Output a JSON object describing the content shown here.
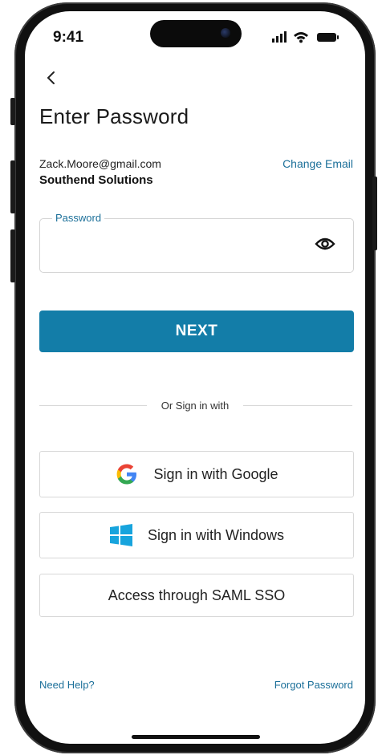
{
  "status_bar": {
    "time": "9:41"
  },
  "nav": {
    "back_glyph": "‹"
  },
  "page": {
    "title": "Enter Password",
    "email": "Zack.Moore@gmail.com",
    "company": "Southend Solutions",
    "change_email_label": "Change Email"
  },
  "password_field": {
    "label": "Password",
    "value": "",
    "visibility_icon": "eye-icon"
  },
  "next_button": {
    "label": "NEXT"
  },
  "divider": {
    "text": "Or Sign in with"
  },
  "sso_buttons": [
    {
      "label": "Sign in with Google",
      "icon": "google-icon"
    },
    {
      "label": "Sign in with Windows",
      "icon": "windows-icon"
    },
    {
      "label": "Access through SAML SSO",
      "icon": ""
    }
  ],
  "footer": {
    "help_label": "Need Help?",
    "forgot_label": "Forgot Password"
  },
  "colors": {
    "accent": "#137da8",
    "link": "#1b6f99",
    "border": "#d4d4d4"
  }
}
